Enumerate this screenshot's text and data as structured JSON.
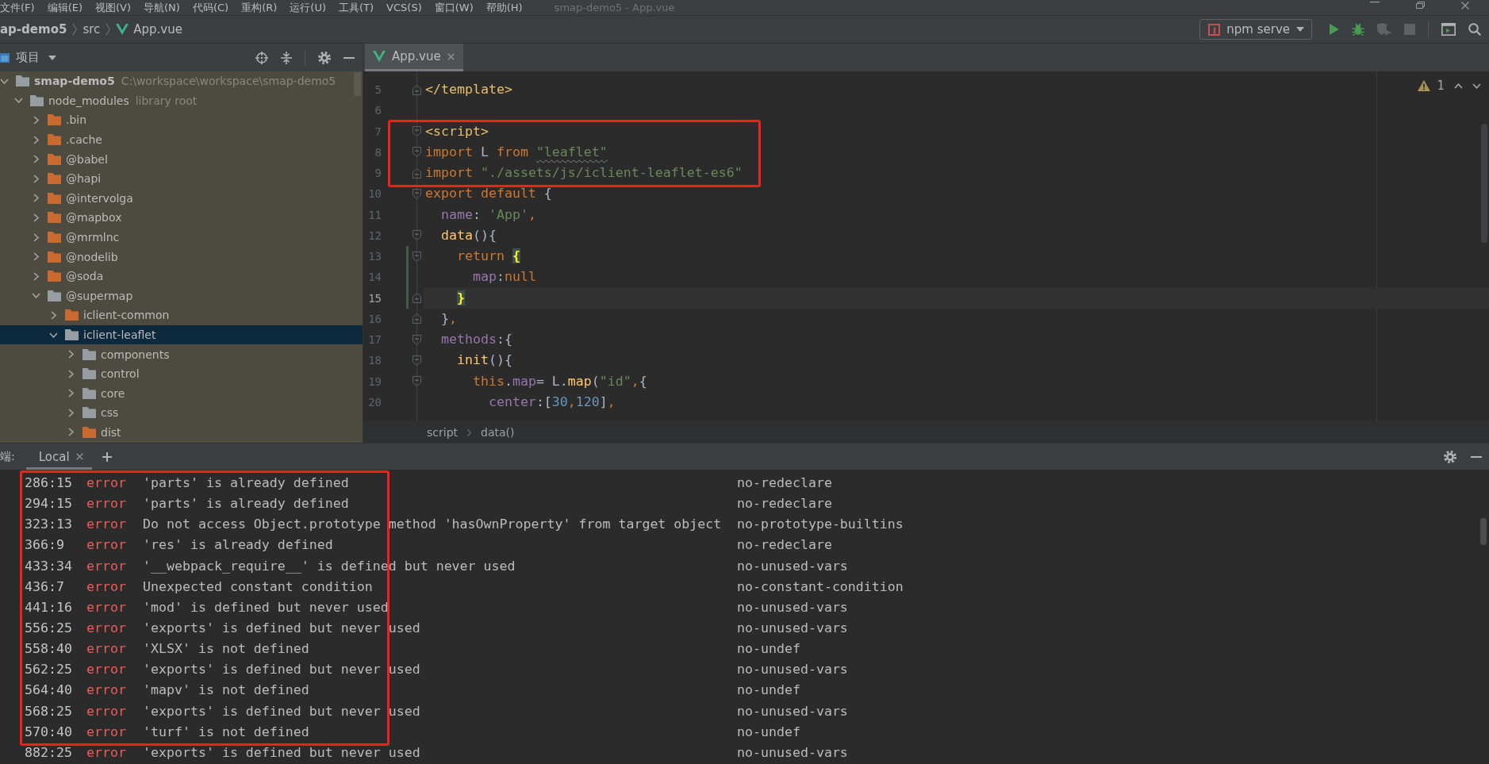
{
  "menu_bar": {
    "items": [
      "文件(F)",
      "编辑(E)",
      "视图(V)",
      "导航(N)",
      "代码(C)",
      "重构(R)",
      "运行(U)",
      "工具(T)",
      "VCS(S)",
      "窗口(W)",
      "帮助(H)"
    ],
    "title": "smap-demo5 - App.vue"
  },
  "nav_bar": {
    "breadcrumbs": [
      {
        "label": "ap-demo5",
        "kind": "project"
      },
      {
        "label": "src",
        "kind": "folder"
      },
      {
        "label": "App.vue",
        "kind": "vue-file"
      }
    ],
    "run_config": "npm serve"
  },
  "project_panel": {
    "title": "项目",
    "tree": [
      {
        "label": "smap-demo5",
        "hint": "C:\\workspace\\workspace\\smap-demo5",
        "color": "#969da3",
        "expanded": true,
        "selected": false,
        "children": [
          {
            "label": "node_modules",
            "hint": "library root",
            "color": "#969da3",
            "expanded": true,
            "selected": false,
            "children": [
              {
                "label": ".bin",
                "color": "#c96b30",
                "expanded": false,
                "selected": false
              },
              {
                "label": ".cache",
                "color": "#c96b30",
                "expanded": false,
                "selected": false
              },
              {
                "label": "@babel",
                "color": "#c96b30",
                "expanded": false,
                "selected": false
              },
              {
                "label": "@hapi",
                "color": "#c96b30",
                "expanded": false,
                "selected": false
              },
              {
                "label": "@intervolga",
                "color": "#c96b30",
                "expanded": false,
                "selected": false
              },
              {
                "label": "@mapbox",
                "color": "#c96b30",
                "expanded": false,
                "selected": false
              },
              {
                "label": "@mrmlnc",
                "color": "#c96b30",
                "expanded": false,
                "selected": false
              },
              {
                "label": "@nodelib",
                "color": "#c96b30",
                "expanded": false,
                "selected": false
              },
              {
                "label": "@soda",
                "color": "#c96b30",
                "expanded": false,
                "selected": false
              },
              {
                "label": "@supermap",
                "color": "#969da3",
                "expanded": true,
                "selected": false,
                "children": [
                  {
                    "label": "iclient-common",
                    "color": "#c96b30",
                    "expanded": false,
                    "selected": false
                  },
                  {
                    "label": "iclient-leaflet",
                    "color": "#969da3",
                    "expanded": true,
                    "selected": true,
                    "children": [
                      {
                        "label": "components",
                        "color": "#969da3",
                        "expanded": false,
                        "selected": false
                      },
                      {
                        "label": "control",
                        "color": "#969da3",
                        "expanded": false,
                        "selected": false
                      },
                      {
                        "label": "core",
                        "color": "#969da3",
                        "expanded": false,
                        "selected": false
                      },
                      {
                        "label": "css",
                        "color": "#969da3",
                        "expanded": false,
                        "selected": false
                      },
                      {
                        "label": "dist",
                        "color": "#c96b30",
                        "expanded": false,
                        "selected": false
                      }
                    ]
                  }
                ]
              }
            ]
          }
        ]
      }
    ]
  },
  "editor": {
    "tabs": [
      {
        "label": "App.vue",
        "selected": true
      }
    ],
    "warning_count": "1",
    "blocks": [
      {
        "framed": false,
        "changed": false,
        "lines": [
          {
            "number": "5",
            "kind": "fold-end",
            "current": false,
            "tokens": [
              {
                "text": "</template>",
                "kind": "tag"
              }
            ]
          },
          {
            "number": "6",
            "kind": "plain",
            "current": false
          }
        ]
      },
      {
        "framed": true,
        "changed": false,
        "lines": [
          {
            "number": "7",
            "kind": "fold-start",
            "current": false,
            "tokens": [
              {
                "text": "<script>",
                "kind": "tag"
              }
            ]
          },
          {
            "number": "8",
            "kind": "fold-start",
            "current": false,
            "tokens": [
              {
                "text": "import ",
                "kind": "keyword"
              },
              {
                "text": "L ",
                "kind": "plain"
              },
              {
                "text": "from ",
                "kind": "keyword"
              },
              {
                "text": "\"leaflet\"",
                "kind": "string-flagged"
              }
            ]
          },
          {
            "number": "9",
            "kind": "fold-end",
            "current": false,
            "tokens": [
              {
                "text": "import ",
                "kind": "keyword"
              },
              {
                "text": "\"./assets/js/iclient-leaflet-es6\"",
                "kind": "string"
              }
            ]
          }
        ]
      },
      {
        "framed": false,
        "changed": false,
        "lines": [
          {
            "number": "10",
            "kind": "fold-start",
            "current": false,
            "tokens": [
              {
                "text": "export default ",
                "kind": "keyword"
              },
              {
                "text": "{",
                "kind": "plain"
              }
            ]
          },
          {
            "number": "11",
            "kind": "plain",
            "current": false,
            "tokens": [
              {
                "text": "  name",
                "kind": "property"
              },
              {
                "text": ": ",
                "kind": "plain"
              },
              {
                "text": "'App'",
                "kind": "string"
              },
              {
                "text": ",",
                "kind": "keyword"
              }
            ]
          },
          {
            "number": "12",
            "kind": "fold-start",
            "current": false,
            "tokens": [
              {
                "text": "  data",
                "kind": "function"
              },
              {
                "text": "(){",
                "kind": "plain"
              }
            ]
          }
        ]
      },
      {
        "framed": false,
        "changed": true,
        "lines": [
          {
            "number": "13",
            "kind": "fold-start",
            "current": false,
            "tokens": [
              {
                "text": "    return ",
                "kind": "keyword"
              },
              {
                "text": "{",
                "kind": "brace-match"
              }
            ]
          },
          {
            "number": "14",
            "kind": "plain",
            "current": false,
            "tokens": [
              {
                "text": "      map",
                "kind": "property"
              },
              {
                "text": ":",
                "kind": "plain"
              },
              {
                "text": "null",
                "kind": "keyword"
              }
            ]
          },
          {
            "number": "15",
            "kind": "fold-end",
            "current": true,
            "tokens": [
              {
                "text": "    }",
                "kind": "brace-match"
              }
            ]
          }
        ]
      },
      {
        "framed": false,
        "changed": false,
        "lines": [
          {
            "number": "16",
            "kind": "fold-end",
            "current": false,
            "tokens": [
              {
                "text": "  }",
                "kind": "plain"
              },
              {
                "text": ",",
                "kind": "keyword"
              }
            ]
          },
          {
            "number": "17",
            "kind": "fold-start",
            "current": false,
            "tokens": [
              {
                "text": "  methods",
                "kind": "property"
              },
              {
                "text": ":{",
                "kind": "plain"
              }
            ]
          },
          {
            "number": "18",
            "kind": "fold-start",
            "current": false,
            "tokens": [
              {
                "text": "    init",
                "kind": "function"
              },
              {
                "text": "(){",
                "kind": "plain"
              }
            ]
          },
          {
            "number": "19",
            "kind": "fold-start",
            "current": false,
            "tokens": [
              {
                "text": "      this",
                "kind": "keyword"
              },
              {
                "text": ".",
                "kind": "plain"
              },
              {
                "text": "map",
                "kind": "property"
              },
              {
                "text": "= L.",
                "kind": "plain"
              },
              {
                "text": "map",
                "kind": "function"
              },
              {
                "text": "(",
                "kind": "plain"
              },
              {
                "text": "\"id\"",
                "kind": "string"
              },
              {
                "text": ",",
                "kind": "keyword"
              },
              {
                "text": "{",
                "kind": "plain"
              }
            ]
          },
          {
            "number": "20",
            "kind": "plain",
            "current": false,
            "tokens": [
              {
                "text": "        center",
                "kind": "property"
              },
              {
                "text": ":[",
                "kind": "plain"
              },
              {
                "text": "30",
                "kind": "number"
              },
              {
                "text": ",",
                "kind": "keyword"
              },
              {
                "text": "120",
                "kind": "number"
              },
              {
                "text": "]",
                "kind": "plain"
              },
              {
                "text": ",",
                "kind": "keyword"
              }
            ]
          }
        ]
      }
    ],
    "breadcrumbs": [
      "script",
      "data()"
    ]
  },
  "terminal": {
    "title": "端:",
    "tabs": [
      {
        "label": "Local",
        "selected": true
      }
    ],
    "blocks": [
      {
        "framed": true,
        "rows": [
          {
            "location": "286:15",
            "severity": "error",
            "message": "'parts' is already defined",
            "rule": "no-redeclare"
          },
          {
            "location": "294:15",
            "severity": "error",
            "message": "'parts' is already defined",
            "rule": "no-redeclare"
          },
          {
            "location": "323:13",
            "severity": "error",
            "message": "Do not access Object.prototype method 'hasOwnProperty' from target object",
            "rule": "no-prototype-builtins"
          },
          {
            "location": "366:9",
            "severity": "error",
            "message": "'res' is already defined",
            "rule": "no-redeclare"
          },
          {
            "location": "433:34",
            "severity": "error",
            "message": "'__webpack_require__' is defined but never used",
            "rule": "no-unused-vars"
          },
          {
            "location": "436:7",
            "severity": "error",
            "message": "Unexpected constant condition",
            "rule": "no-constant-condition"
          },
          {
            "location": "441:16",
            "severity": "error",
            "message": "'mod' is defined but never used",
            "rule": "no-unused-vars"
          },
          {
            "location": "556:25",
            "severity": "error",
            "message": "'exports' is defined but never used",
            "rule": "no-unused-vars"
          },
          {
            "location": "558:40",
            "severity": "error",
            "message": "'XLSX' is not defined",
            "rule": "no-undef"
          },
          {
            "location": "562:25",
            "severity": "error",
            "message": "'exports' is defined but never used",
            "rule": "no-unused-vars"
          },
          {
            "location": "564:40",
            "severity": "error",
            "message": "'mapv' is not defined",
            "rule": "no-undef"
          },
          {
            "location": "568:25",
            "severity": "error",
            "message": "'exports' is defined but never used",
            "rule": "no-unused-vars"
          },
          {
            "location": "570:40",
            "severity": "error",
            "message": "'turf' is not defined",
            "rule": "no-undef"
          }
        ]
      },
      {
        "framed": false,
        "rows": [
          {
            "location": "882:25",
            "severity": "error",
            "message": "'exports' is defined but never used",
            "rule": "no-unused-vars"
          }
        ]
      }
    ]
  }
}
